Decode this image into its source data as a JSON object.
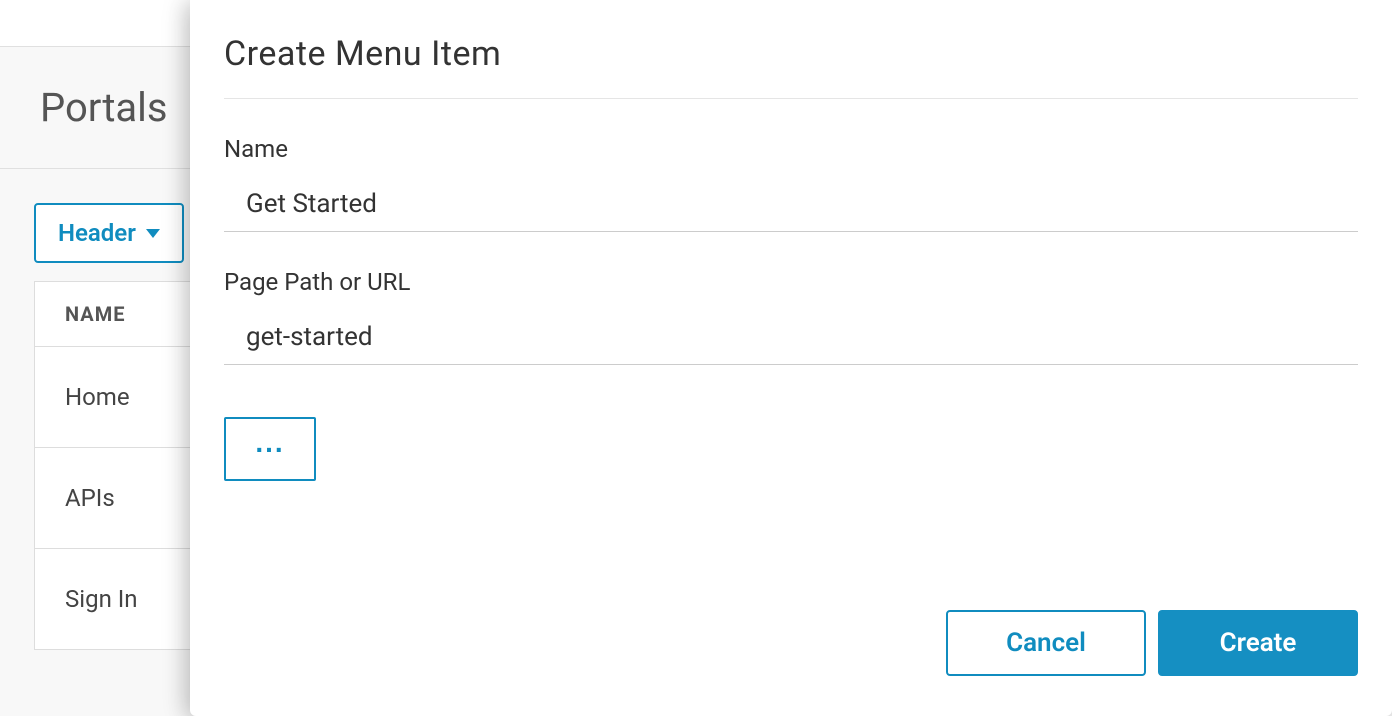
{
  "background": {
    "page_title": "Portals",
    "dropdown_label": "Header",
    "table": {
      "header": "NAME",
      "rows": [
        "Home",
        "APIs",
        "Sign In"
      ]
    }
  },
  "modal": {
    "title": "Create Menu Item",
    "name_label": "Name",
    "name_value": "Get Started",
    "path_label": "Page Path or URL",
    "path_value": "get-started",
    "more_label": "...",
    "cancel_label": "Cancel",
    "create_label": "Create"
  }
}
